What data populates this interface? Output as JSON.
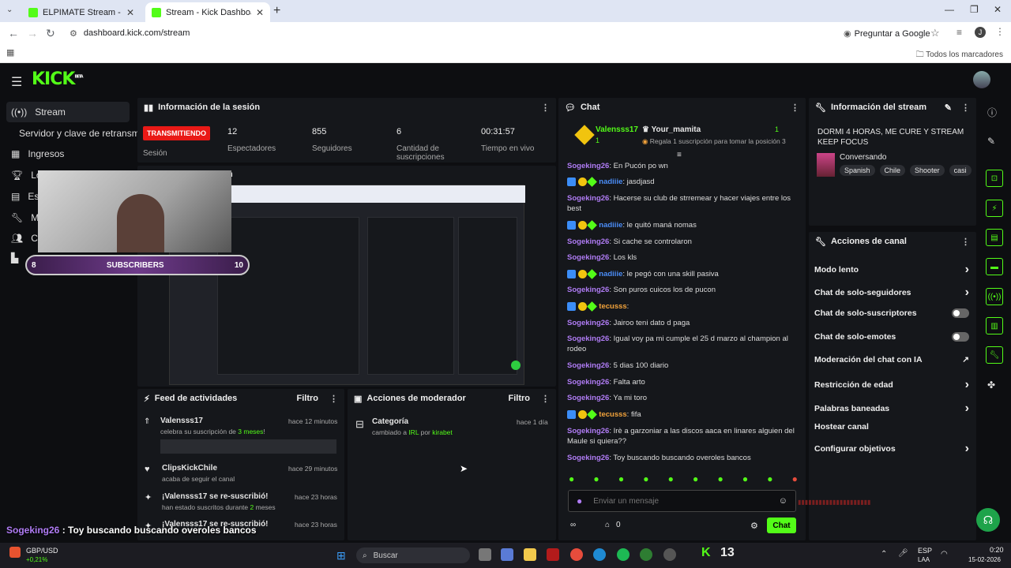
{
  "browser": {
    "tabs": [
      {
        "title": "ELPIMATE Stream - Watch Live"
      },
      {
        "title": "Stream - Kick Dashboard"
      }
    ],
    "url": "dashboard.kick.com/stream",
    "translate_label": "Preguntar a Google",
    "bookmarks_label": "Todos los marcadores",
    "profile_initial": "J"
  },
  "brand": {
    "logo": "KICK",
    "superscript": "BETA",
    "accent": "#53fc18"
  },
  "sidebar": {
    "items": [
      {
        "label": "Stream",
        "icon": "broadcast-icon"
      },
      {
        "label": "Servidor y clave de retransmi",
        "icon": ""
      },
      {
        "label": "Ingresos",
        "icon": "grid-icon"
      },
      {
        "label": "Lo",
        "icon": "trophy-icon"
      },
      {
        "label": "Es",
        "icon": "chart-icon"
      },
      {
        "label": "Mo",
        "icon": "wrench-icon"
      },
      {
        "label": "Co",
        "icon": "users-icon"
      }
    ]
  },
  "session": {
    "title": "Información de la sesión",
    "status": "TRANSMITIENDO",
    "status_label": "Sesión",
    "stats": [
      {
        "value": "12",
        "label": "Espectadores"
      },
      {
        "value": "855",
        "label": "Seguidores"
      },
      {
        "value": "6",
        "label": "Cantidad de suscripciones"
      },
      {
        "value": "00:31:57",
        "label": "Tiempo en vivo"
      }
    ]
  },
  "preview": {
    "title": "n"
  },
  "webcam_overlay": {
    "left_count": "8",
    "label": "SUBSCRIBERS",
    "right_count": "10"
  },
  "activity": {
    "title": "Feed de actividades",
    "filter_label": "Filtro",
    "items": [
      {
        "user": "Valensss17",
        "time": "hace 12 minutos",
        "desc_pre": "celebra su suscripción de ",
        "desc_hl": "3 meses",
        "desc_post": "!"
      },
      {
        "user": "ClipsKickChile",
        "time": "hace 29 minutos",
        "desc_pre": "acaba de seguir el canal",
        "desc_hl": "",
        "desc_post": ""
      },
      {
        "user": "¡Valensss17 se re-suscribió!",
        "time": "hace 23 horas",
        "desc_pre": "han estado suscritos durante ",
        "desc_hl": "2",
        "desc_post": " meses"
      },
      {
        "user": "¡Valensss17 se re-suscribió!",
        "time": "hace 23 horas",
        "desc_pre": "",
        "desc_hl": "",
        "desc_post": ""
      }
    ]
  },
  "modactions": {
    "title": "Acciones de moderador",
    "filter_label": "Filtro",
    "items": [
      {
        "title": "Categoría",
        "time": "hace 1 día",
        "desc_pre": "cambiado a ",
        "desc_hl": "IRL",
        "desc_mid": " por ",
        "desc_user": "kirabet"
      }
    ]
  },
  "chat": {
    "title": "Chat",
    "pinned": {
      "gifter": "Valensss17",
      "gift_count": "1",
      "recipient": "Your_mamita",
      "recipient_count": "1",
      "note": "Regala 1 suscripción para tomar la posición 3"
    },
    "messages": [
      {
        "user": "Sogeking26",
        "text": ": En Pucón po wn",
        "badges": false,
        "color": "u1"
      },
      {
        "user": "nadiiie",
        "text": ": jasdjasd",
        "badges": true,
        "color": "u2"
      },
      {
        "user": "Sogeking26",
        "text": ": Hacerse su club de strremear y hacer viajes entre los best",
        "badges": false,
        "color": "u1"
      },
      {
        "user": "nadiiie",
        "text": ": le quitó maná nomas",
        "badges": true,
        "color": "u2"
      },
      {
        "user": "Sogeking26",
        "text": ": Si cache se controlaron",
        "badges": false,
        "color": "u1"
      },
      {
        "user": "Sogeking26",
        "text": ": Los kls",
        "badges": false,
        "color": "u1"
      },
      {
        "user": "nadiiie",
        "text": ": le pegó con una skill pasiva",
        "badges": true,
        "color": "u2"
      },
      {
        "user": "Sogeking26",
        "text": ": Son puros cuicos los de pucon",
        "badges": false,
        "color": "u1"
      },
      {
        "user": "tecusss",
        "text": ": ",
        "badges": true,
        "color": "u3"
      },
      {
        "user": "Sogeking26",
        "text": ": Jairoo teni dato d paga",
        "badges": false,
        "color": "u1"
      },
      {
        "user": "Sogeking26",
        "text": ": Igual voy pa mi cumple el 25 d marzo al champion al rodeo",
        "badges": false,
        "color": "u1"
      },
      {
        "user": "Sogeking26",
        "text": ": 5 dias 100 diario",
        "badges": false,
        "color": "u1"
      },
      {
        "user": "Sogeking26",
        "text": ": Falta arto",
        "badges": false,
        "color": "u1"
      },
      {
        "user": "Sogeking26",
        "text": ": Ya mi toro",
        "badges": false,
        "color": "u1"
      },
      {
        "user": "tecusss",
        "text": ": fifa",
        "badges": true,
        "color": "u3"
      },
      {
        "user": "Sogeking26",
        "text": ": Irè a garzoniar a las discos aaca en linares alguien del Maule si quiera??",
        "badges": false,
        "color": "u1"
      },
      {
        "user": "Sogeking26",
        "text": ": Toy buscando buscando overoles bancos",
        "badges": false,
        "color": "u1"
      }
    ],
    "input_placeholder": "Enviar un mensaje",
    "points_value": "0",
    "send_label": "Chat"
  },
  "stream_info": {
    "title": "Información del stream",
    "stream_title": "DORMI 4 HORAS, ME CURE Y STREAM KEEP FOCUS",
    "category": "Conversando",
    "tags": [
      "Spanish",
      "Chile",
      "Shooter",
      "casi"
    ]
  },
  "channel_actions": {
    "title": "Acciones de canal",
    "items": [
      {
        "label": "Modo lento",
        "control": "chevron"
      },
      {
        "label": "Chat de solo-seguidores",
        "control": "chevron"
      },
      {
        "label": "Chat de solo-suscriptores",
        "control": "toggle"
      },
      {
        "label": "Chat de solo-emotes",
        "control": "toggle"
      },
      {
        "label": "Moderación del chat con IA",
        "control": "external"
      },
      {
        "label": "Restricción de edad",
        "control": "chevron"
      },
      {
        "label": "Palabras baneadas",
        "control": "chevron"
      },
      {
        "label": "Hostear canal",
        "control": "none"
      },
      {
        "label": "Configurar objetivos",
        "control": "chevron"
      }
    ]
  },
  "overlay_chat": {
    "user": "Sogeking26",
    "text": " : Toy buscando buscando overoles bancos"
  },
  "taskbar": {
    "ticker_name": "GBP/USD",
    "ticker_change": "+0,21%",
    "search_placeholder": "Buscar",
    "lang": "ESP",
    "lang2": "LAA",
    "time": "0:20",
    "date": "15-02-2026"
  }
}
